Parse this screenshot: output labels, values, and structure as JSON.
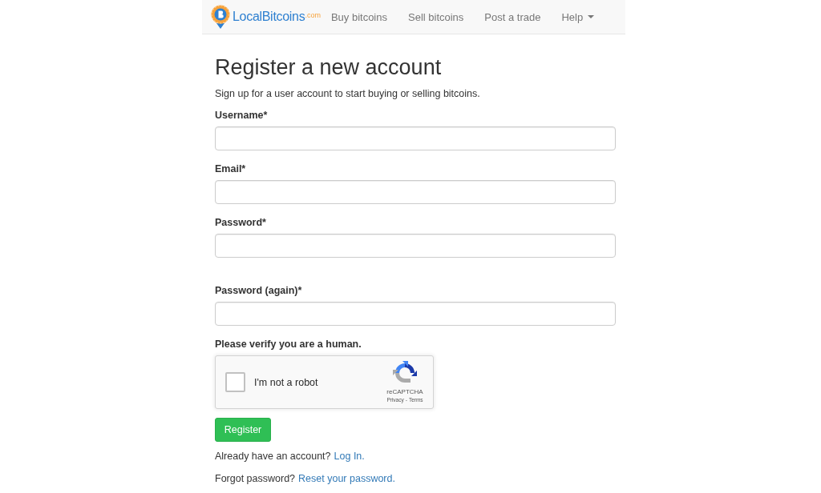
{
  "navbar": {
    "logo": {
      "name": "LocalBitcoins",
      "suffix": ".com"
    },
    "items": [
      {
        "label": "Buy bitcoins",
        "kind": "link"
      },
      {
        "label": "Sell bitcoins",
        "kind": "link"
      },
      {
        "label": "Post a trade",
        "kind": "link"
      },
      {
        "label": "Help",
        "kind": "dropdown"
      }
    ]
  },
  "page": {
    "title": "Register a new account",
    "subtitle": "Sign up for a user account to start buying or selling bitcoins."
  },
  "form": {
    "fields": [
      {
        "label": "Username*"
      },
      {
        "label": "Email*"
      },
      {
        "label": "Password*"
      },
      {
        "label": "Password (again)*"
      }
    ],
    "captcha": {
      "heading": "Please verify you are a human.",
      "checkbox_label": "I'm not a robot",
      "checked": false,
      "brand": "reCAPTCHA",
      "links": [
        "Privacy",
        "Terms"
      ],
      "separator": "-"
    },
    "submit": "Register"
  },
  "footer_lines": [
    {
      "text": "Already have an account?",
      "link": "Log In."
    },
    {
      "text": "Forgot password?",
      "link": "Reset your password."
    }
  ]
}
